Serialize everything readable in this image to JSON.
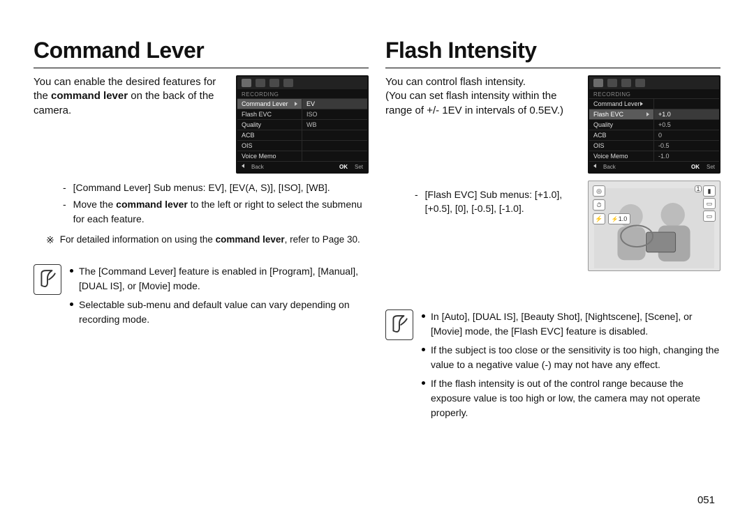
{
  "page_number": "051",
  "left": {
    "heading": "Command Lever",
    "intro_part1": "You can enable the desired features for the ",
    "intro_bold": "command lever",
    "intro_part2": " on the back of the camera.",
    "submenu_label": "[Command Lever] Sub menus: EV], [EV(A, S)], [ISO], [WB].",
    "move_line_pre": "Move the ",
    "move_line_bold": "command lever",
    "move_line_post": " to the left or right to select the submenu for each feature.",
    "footnote_pre": "For detailed information on using the ",
    "footnote_bold": "command lever",
    "footnote_post": ", refer to Page 30.",
    "bullets": [
      "The [Command Lever] feature is enabled in [Program], [Manual], [DUAL IS], or [Movie] mode.",
      "Selectable sub-menu and default value can vary depending on recording mode."
    ],
    "menu": {
      "section": "RECORDING",
      "rows": [
        {
          "l": "Command Lever",
          "r": "EV",
          "hl": true
        },
        {
          "l": "Flash EVC",
          "r": "ISO"
        },
        {
          "l": "Quality",
          "r": "WB"
        },
        {
          "l": "ACB",
          "r": ""
        },
        {
          "l": "OIS",
          "r": ""
        },
        {
          "l": "Voice Memo",
          "r": ""
        }
      ],
      "back": "Back",
      "ok": "OK",
      "set": "Set"
    }
  },
  "right": {
    "heading": "Flash Intensity",
    "intro_l1": "You can control flash intensity.",
    "intro_l2": "(You can set flash intensity within the range of +/- 1EV in intervals of 0.5EV.)",
    "submenu_label": "[Flash EVC] Sub menus: [+1.0], [+0.5], [0], [-0.5], [-1.0].",
    "bullets": [
      "In [Auto], [DUAL IS], [Beauty Shot], [Nightscene], [Scene], or [Movie] mode, the [Flash EVC] feature is disabled.",
      "If the subject is too close or the sensitivity is too high, changing the value to a negative value (-) may not have any effect.",
      "If the flash intensity is out of the control range because the exposure value is too high or low, the camera may not operate properly."
    ],
    "menu": {
      "section": "RECORDING",
      "rows": [
        {
          "l": "Command Lever",
          "r": ""
        },
        {
          "l": "Flash EVC",
          "r": "+1.0",
          "hl": true
        },
        {
          "l": "Quality",
          "r": "+0.5"
        },
        {
          "l": "ACB",
          "r": "0"
        },
        {
          "l": "OIS",
          "r": "-0.5"
        },
        {
          "l": "Voice Memo",
          "r": "-1.0"
        }
      ],
      "back": "Back",
      "ok": "OK",
      "set": "Set"
    },
    "photo_overlay": {
      "flash_badge": "1.0"
    }
  }
}
